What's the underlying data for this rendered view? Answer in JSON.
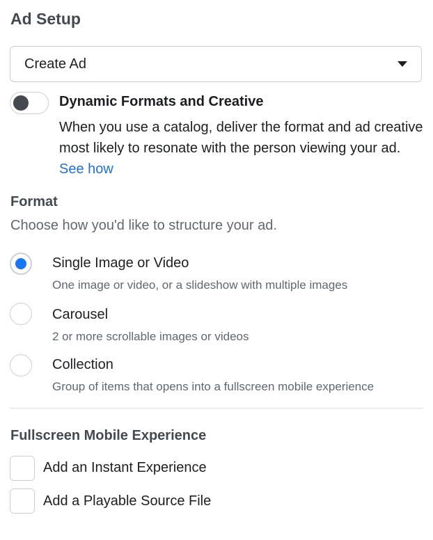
{
  "ad_setup": {
    "title": "Ad Setup",
    "select_value": "Create Ad",
    "dynamic": {
      "title": "Dynamic Formats and Creative",
      "description": "When you use a catalog, deliver the format and ad creative most likely to resonate with the person viewing your ad.",
      "link": "See how",
      "enabled": false
    }
  },
  "format": {
    "title": "Format",
    "subtitle": "Choose how you'd like to structure your ad.",
    "options": [
      {
        "label": "Single Image or Video",
        "description": "One image or video, or a slideshow with multiple images",
        "selected": true
      },
      {
        "label": "Carousel",
        "description": "2 or more scrollable images or videos",
        "selected": false
      },
      {
        "label": "Collection",
        "description": "Group of items that opens into a fullscreen mobile experience",
        "selected": false
      }
    ]
  },
  "fullscreen": {
    "title": "Fullscreen Mobile Experience",
    "options": [
      {
        "label": "Add an Instant Experience",
        "checked": false
      },
      {
        "label": "Add a Playable Source File",
        "checked": false
      }
    ]
  },
  "colors": {
    "accent": "#1877f2",
    "link": "#216fdb",
    "border": "#ccd0d5"
  },
  "icons": [
    "chevron-down-icon",
    "toggle-knob"
  ]
}
